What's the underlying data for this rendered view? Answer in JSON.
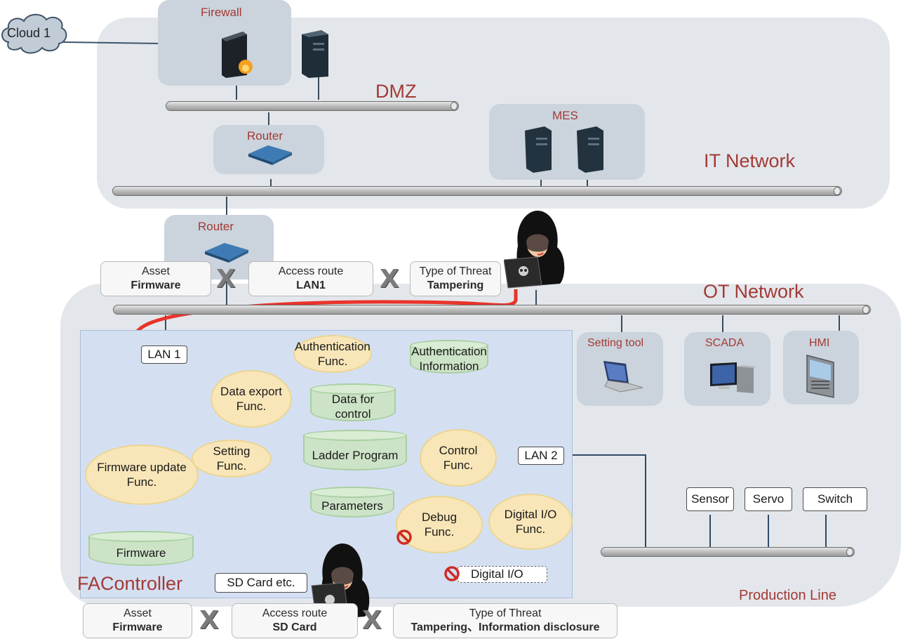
{
  "zones": {
    "it_network": "IT Network",
    "dmz": "DMZ",
    "ot_network": "OT Network",
    "production_line": "Production Line",
    "fa_controller": "FAController"
  },
  "cloud": {
    "label": "Cloud 1",
    "icon": "cloud-icon"
  },
  "it_devices": {
    "firewall": {
      "label": "Firewall",
      "icon": "firewall-icon"
    },
    "dmz_server": {
      "icon": "server-icon"
    },
    "dmz_router": {
      "label": "Router",
      "icon": "router-icon"
    },
    "mes": {
      "label": "MES",
      "icon": "server-icon"
    }
  },
  "ot_devices": {
    "router": {
      "label": "Router",
      "icon": "router-icon"
    },
    "setting_tool": {
      "label": "Setting tool",
      "icon": "laptop-icon"
    },
    "scada": {
      "label": "SCADA",
      "icon": "desktop-computer-icon"
    },
    "hmi": {
      "label": "HMI",
      "icon": "touch-panel-icon"
    }
  },
  "production_line_devices": [
    "Sensor",
    "Servo",
    "Switch"
  ],
  "controller": {
    "ports": {
      "lan1": "LAN 1",
      "lan2": "LAN 2",
      "sd_card": "SD Card etc.",
      "digital_io": "Digital I/O"
    },
    "functions": {
      "authentication": [
        "Authentication",
        "Func."
      ],
      "data_export": [
        "Data export",
        "Func."
      ],
      "setting": [
        "Setting",
        "Func."
      ],
      "firmware_update": [
        "Firmware update",
        "Func."
      ],
      "control": [
        "Control",
        "Func."
      ],
      "debug": [
        "Debug",
        "Func."
      ],
      "digital_io": [
        "Digital I/O",
        "Func."
      ]
    },
    "data_stores": {
      "authentication_info": [
        "Authentication",
        "Information"
      ],
      "data_for_control": [
        "Data for",
        "control"
      ],
      "ladder_program": "Ladder Program",
      "parameters": "Parameters",
      "firmware": "Firmware"
    },
    "disabled_icon": "prohibited-icon"
  },
  "threat_1": {
    "asset_title": "Asset",
    "asset_value": "Firmware",
    "route_title": "Access route",
    "route_value": "LAN1",
    "threat_title": "Type of Threat",
    "threat_value": "Tampering",
    "operator": "X",
    "attacker_icon": "hooded-hacker-icon"
  },
  "threat_2": {
    "asset_title": "Asset",
    "asset_value": "Firmware",
    "route_title": "Access route",
    "route_value": "SD Card",
    "threat_title": "Type of Threat",
    "threat_value": "Tampering、Information disclosure",
    "operator": "X",
    "attacker_icon": "hooded-hacker-icon"
  },
  "colors": {
    "attack_path": "#e8342a",
    "zone_label": "#a33a35",
    "zone_bg": "#e3e7ec",
    "function_fill": "#f8e6b8",
    "datastore_fill": "#cce3c7",
    "controller_bg": "#d4e0f2"
  }
}
